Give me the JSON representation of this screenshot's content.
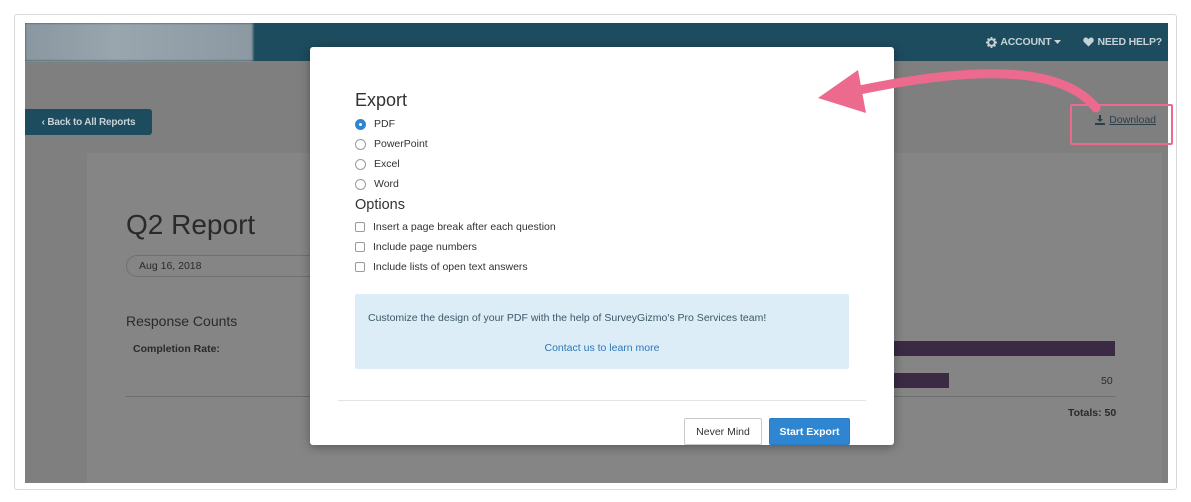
{
  "topbar": {
    "account_label": "ACCOUNT",
    "help_label": "NEED HELP?"
  },
  "page": {
    "back_label": "‹ Back to All Reports",
    "download_label": "Download",
    "report_title": "Q2 Report",
    "report_date": "Aug 16, 2018",
    "response_counts": "Response Counts",
    "completion_rate": "Completion Rate:",
    "value": "50",
    "totals": "Totals: 50"
  },
  "modal": {
    "export_heading": "Export",
    "formats": [
      {
        "label": "PDF",
        "selected": true
      },
      {
        "label": "PowerPoint",
        "selected": false
      },
      {
        "label": "Excel",
        "selected": false
      },
      {
        "label": "Word",
        "selected": false
      }
    ],
    "options_heading": "Options",
    "options": [
      {
        "label": "Insert a page break after each question",
        "checked": false
      },
      {
        "label": "Include page numbers",
        "checked": false
      },
      {
        "label": "Include lists of open text answers",
        "checked": false
      }
    ],
    "promo_text": "Customize the design of your PDF with the help of SurveyGizmo's Pro Services team!",
    "promo_link": "Contact us to learn more",
    "cancel_label": "Never Mind",
    "submit_label": "Start Export"
  },
  "colors": {
    "primary": "#2e86d3",
    "navbar": "#1d4c5e",
    "annotation": "#ec6a8e",
    "bar": "#3a2a44"
  }
}
